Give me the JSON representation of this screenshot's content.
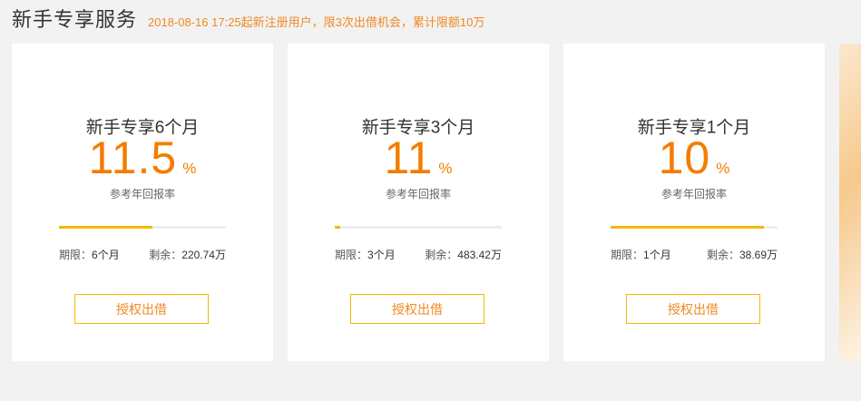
{
  "header": {
    "title": "新手专享服务",
    "note": "2018-08-16 17:25起新注册用户，限3次出借机会，累计限额10万"
  },
  "products": [
    {
      "name": "新手专享6个月",
      "rate": "11.5",
      "rate_unit": "%",
      "rate_label": "参考年回报率",
      "progress": 0.56,
      "term_label": "期限：",
      "term_value": "6个月",
      "remain_label": "剩余：",
      "remain_value": "220.74万",
      "button": "授权出借"
    },
    {
      "name": "新手专享3个月",
      "rate": "11",
      "rate_unit": "%",
      "rate_label": "参考年回报率",
      "progress": 0.03,
      "term_label": "期限：",
      "term_value": "3个月",
      "remain_label": "剩余：",
      "remain_value": "483.42万",
      "button": "授权出借"
    },
    {
      "name": "新手专享1个月",
      "rate": "10",
      "rate_unit": "%",
      "rate_label": "参考年回报率",
      "progress": 0.92,
      "term_label": "期限：",
      "term_value": "1个月",
      "remain_label": "剩余：",
      "remain_value": "38.69万",
      "button": "授权出借"
    }
  ],
  "colors": {
    "accent_orange": "#f57c00",
    "note_orange": "#f08a24",
    "progress_yellow": "#f6b800",
    "background": "#f2f2f2"
  }
}
